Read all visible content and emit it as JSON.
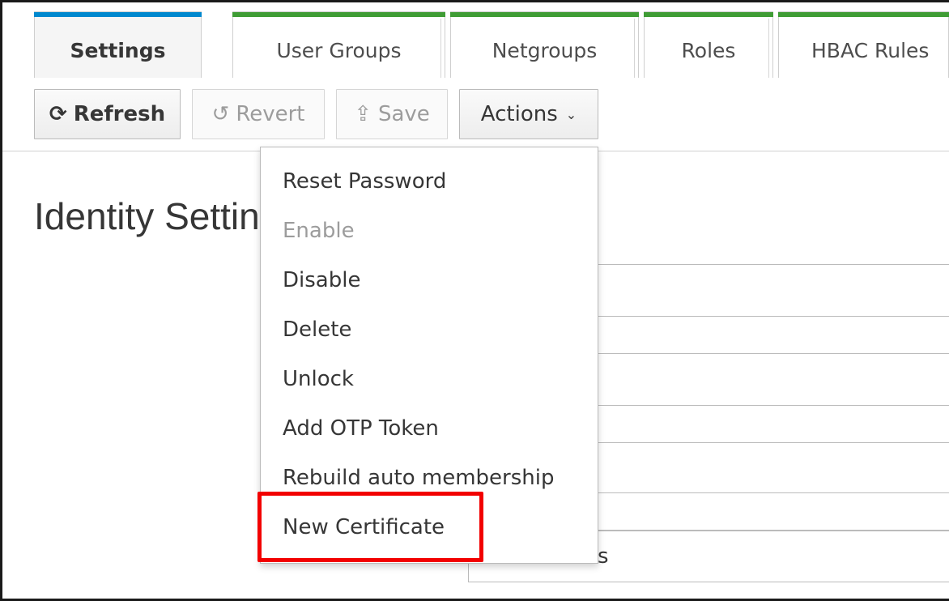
{
  "tabs": [
    {
      "label": "Settings",
      "active": true
    },
    {
      "label": "User Groups",
      "active": false
    },
    {
      "label": "Netgroups",
      "active": false
    },
    {
      "label": "Roles",
      "active": false
    },
    {
      "label": "HBAC Rules",
      "active": false
    }
  ],
  "toolbar": {
    "refresh_label": "Refresh",
    "revert_label": "Revert",
    "save_label": "Save",
    "actions_label": "Actions"
  },
  "page": {
    "title": "Identity Settings",
    "partial_field_text": "ys",
    "partial_field_text2": "s"
  },
  "actions_menu": {
    "items": [
      {
        "label": "Reset Password",
        "enabled": true
      },
      {
        "label": "Enable",
        "enabled": false
      },
      {
        "label": "Disable",
        "enabled": true
      },
      {
        "label": "Delete",
        "enabled": true
      },
      {
        "label": "Unlock",
        "enabled": true
      },
      {
        "label": "Add OTP Token",
        "enabled": true
      },
      {
        "label": "Rebuild auto membership",
        "enabled": true
      },
      {
        "label": "New Certificate",
        "enabled": true,
        "highlighted": true
      }
    ]
  },
  "colors": {
    "active_tab_accent": "#0088ce",
    "tab_accent": "#3f9c35",
    "highlight_box": "#f20000"
  },
  "icons": {
    "refresh": "refresh-icon",
    "revert": "undo-icon",
    "save": "upload-icon",
    "actions": "chevron-down-icon"
  }
}
